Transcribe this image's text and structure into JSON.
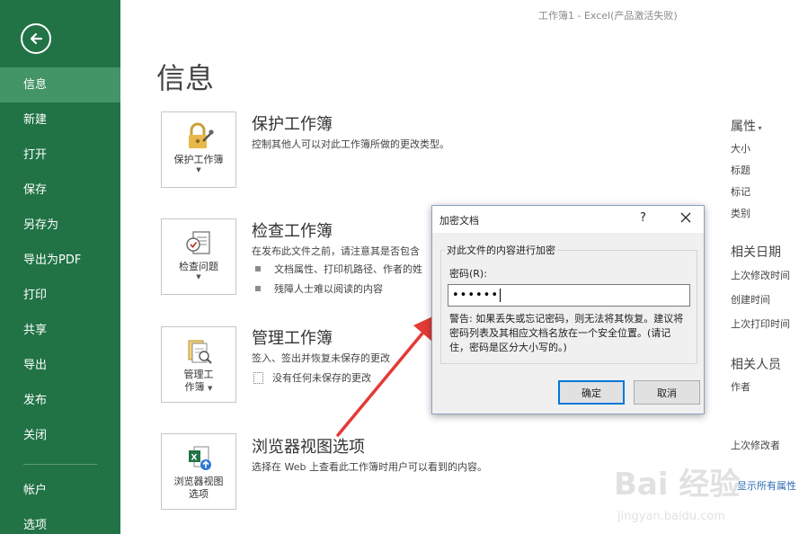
{
  "window": {
    "title": "工作簿1 - Excel(产品激活失败)"
  },
  "sidebar": {
    "back_icon": "back-arrow-icon",
    "items": [
      {
        "label": "信息",
        "active": true
      },
      {
        "label": "新建"
      },
      {
        "label": "打开"
      },
      {
        "label": "保存"
      },
      {
        "label": "另存为"
      },
      {
        "label": "导出为PDF"
      },
      {
        "label": "打印"
      },
      {
        "label": "共享"
      },
      {
        "label": "导出"
      },
      {
        "label": "发布"
      },
      {
        "label": "关闭"
      },
      {
        "label": "帐户"
      },
      {
        "label": "选项"
      }
    ]
  },
  "main": {
    "title": "信息",
    "sections": [
      {
        "button_label": "保护工作簿",
        "title": "保护工作簿",
        "description": "控制其他人可以对此工作簿所做的更改类型。",
        "icon": "lock-key-icon"
      },
      {
        "button_label": "检查问题",
        "title": "检查工作簿",
        "description": "在发布此文件之前，请注意其是否包含",
        "bullets": [
          "文档属性、打印机路径、作者的姓",
          "残障人士难以阅读的内容"
        ],
        "icon": "inspect-document-icon"
      },
      {
        "button_label_line1": "管理工",
        "button_label_line2": "作簿",
        "title": "管理工作簿",
        "description": "签入、签出并恢复未保存的更改",
        "bullets": [
          "没有任何未保存的更改"
        ],
        "icon": "manage-workbook-icon"
      },
      {
        "button_label_line1": "浏览器视图",
        "button_label_line2": "选项",
        "title": "浏览器视图选项",
        "description": "选择在 Web 上查看此工作簿时用户可以看到的内容。",
        "icon": "browser-view-icon"
      }
    ]
  },
  "properties": {
    "heading": "属性",
    "items": [
      "大小",
      "标题",
      "标记",
      "类别"
    ],
    "related_dates_heading": "相关日期",
    "dates": [
      "上次修改时间",
      "创建时间",
      "上次打印时间"
    ],
    "related_people_heading": "相关人员",
    "people": [
      "作者",
      "上次修改者"
    ],
    "show_all": "显示所有属性"
  },
  "dialog": {
    "title": "加密文档",
    "help": "?",
    "group_label": "对此文件的内容进行加密",
    "password_label": "密码(R):",
    "password_value": "••••••",
    "warning": "警告: 如果丢失或忘记密码，则无法将其恢复。建议将密码列表及其相应文档名放在一个安全位置。(请记住，密码是区分大小写的。)",
    "ok_label": "确定",
    "cancel_label": "取消"
  },
  "watermark": {
    "text": "Bai 经验",
    "url_text": "jingyan.baidu.com"
  },
  "colors": {
    "sidebar": "#217346",
    "sidebar_active": "#439467",
    "arrow": "#e53a35",
    "dialog_accent": "#0078d7"
  }
}
